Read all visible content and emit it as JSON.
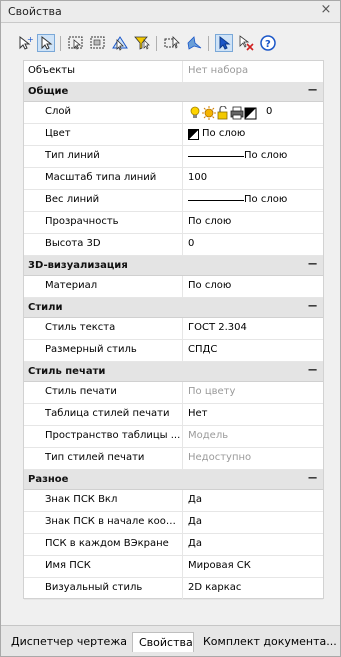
{
  "window": {
    "title": "Свойства",
    "close_glyph": "×"
  },
  "toolbar": {
    "icons": [
      "add-selected-icon",
      "select-objects-icon",
      "window-select-icon",
      "quick-select-icon",
      "pickadd-icon",
      "filter-icon",
      "snap-icon",
      "toggle-value-icon",
      "select-arrow-icon",
      "deselect-icon",
      "help-icon"
    ]
  },
  "properties": {
    "objects": {
      "label": "Объекты",
      "value": "Нет набора"
    },
    "sections": {
      "general": {
        "title": "Общие",
        "rows": {
          "layer": {
            "label": "Слой",
            "value": "0"
          },
          "color": {
            "label": "Цвет",
            "value": "По слою"
          },
          "linetype": {
            "label": "Тип линий",
            "value": "По слою"
          },
          "linetype_scale": {
            "label": "Масштаб типа линий",
            "value": "100"
          },
          "lineweight": {
            "label": "Вес линий",
            "value": "По слою"
          },
          "transparency": {
            "label": "Прозрачность",
            "value": "По слою"
          },
          "height3d": {
            "label": "Высота 3D",
            "value": "0"
          }
        }
      },
      "viz3d": {
        "title": "3D-визуализация",
        "rows": {
          "material": {
            "label": "Материал",
            "value": "По слою"
          }
        }
      },
      "styles": {
        "title": "Стили",
        "rows": {
          "text_style": {
            "label": "Стиль текста",
            "value": "ГОСТ 2.304"
          },
          "dim_style": {
            "label": "Размерный стиль",
            "value": "СПДС"
          }
        }
      },
      "plot_style": {
        "title": "Стиль печати",
        "rows": {
          "plot_style": {
            "label": "Стиль печати",
            "value": "По цвету"
          },
          "plot_table": {
            "label": "Таблица стилей печати",
            "value": "Нет"
          },
          "table_space": {
            "label": "Пространство таблицы ...",
            "value": "Модель"
          },
          "table_type": {
            "label": "Тип стилей печати",
            "value": "Недоступно"
          }
        }
      },
      "misc": {
        "title": "Разное",
        "rows": {
          "ucs_on": {
            "label": "Знак ПСК Вкл",
            "value": "Да"
          },
          "ucs_origin": {
            "label": "Знак ПСК в начале коор...",
            "value": "Да"
          },
          "ucs_per_vp": {
            "label": "ПСК в каждом ВЭкране",
            "value": "Да"
          },
          "ucs_name": {
            "label": "Имя ПСК",
            "value": "Мировая СК"
          },
          "visual_style": {
            "label": "Визуальный стиль",
            "value": "2D каркас"
          }
        }
      }
    },
    "collapse_glyph": "−"
  },
  "tabs": {
    "dwg_manager": "Диспетчер чертежа",
    "properties": "Свойства",
    "doc_set": "Комплект документа..."
  },
  "colors": {
    "active_tab": "#ffffff",
    "section_bg": "#e4e4e4",
    "muted_text": "#9a9a9a"
  }
}
